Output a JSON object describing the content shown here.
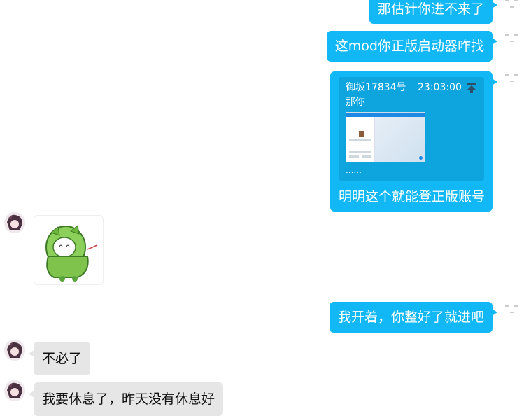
{
  "messages": {
    "m1": "那估计你进不来了",
    "m2": "这mod你正版启动器咋找",
    "m3": {
      "quote_sender": "御坂17834号",
      "quote_time": "23:03:00",
      "quote_text": "那你",
      "quote_more": "......",
      "text": "明明这个就能登正版账号"
    },
    "m5": "我开着，你整好了就进吧",
    "m6": "不必了",
    "m7": "我要休息了，昨天没有休息好"
  },
  "colors": {
    "outgoing": "#12b7f5",
    "incoming": "#e6e6e6"
  },
  "icons": [
    "upload-arrow-icon",
    "status-icon",
    "avatar",
    "sticker-image"
  ]
}
